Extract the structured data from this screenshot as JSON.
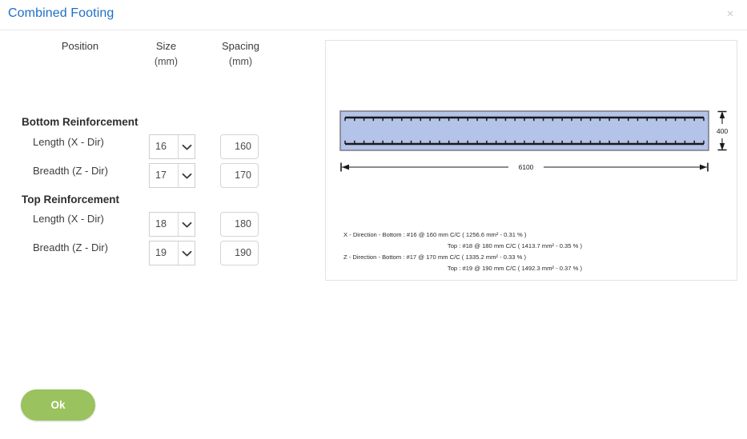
{
  "dialog": {
    "title": "Combined Footing",
    "close_icon": "close-icon",
    "close_glyph": "×"
  },
  "form": {
    "columns": [
      {
        "label": "Position",
        "unit": ""
      },
      {
        "label": "Size",
        "unit": "(mm)"
      },
      {
        "label": "Spacing",
        "unit": "(mm)"
      }
    ],
    "sections": [
      {
        "title": "Bottom Reinforcement",
        "rows": [
          {
            "label": "Length (X - Dir)",
            "size": "16",
            "spacing": "160"
          },
          {
            "label": "Breadth (Z - Dir)",
            "size": "17",
            "spacing": "170"
          }
        ]
      },
      {
        "title": "Top Reinforcement",
        "rows": [
          {
            "label": "Length (X - Dir)",
            "size": "18",
            "spacing": "180"
          },
          {
            "label": "Breadth (Z - Dir)",
            "size": "19",
            "spacing": "190"
          }
        ]
      }
    ]
  },
  "diagram": {
    "dimension_length": "6100",
    "dimension_depth": "400",
    "fill_color": "#b4c3e8",
    "outline_color": "#7f7f8c",
    "rebar_color": "#1a1a1a",
    "annotations": [
      "X - Direction - Bottom : #16 @ 160 mm C/C ( 1256.6 mm² - 0.31 % )",
      "Top : #18 @ 180 mm C/C ( 1413.7 mm² - 0.35 % )",
      "Z - Direction - Bottom : #17 @ 170 mm C/C ( 1335.2 mm² - 0.33 % )",
      "Top : #19 @ 190 mm C/C ( 1492.3 mm² - 0.37 % )"
    ]
  },
  "footer": {
    "ok_label": "Ok",
    "ok_color": "#9ac25e"
  }
}
